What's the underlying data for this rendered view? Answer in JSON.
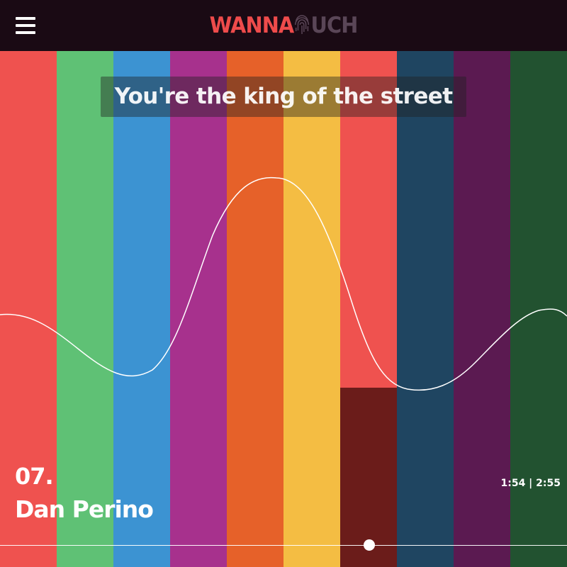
{
  "header": {
    "logo_part1": "WANNA",
    "logo_part2": "UCH",
    "logo_icon": "fingerprint-icon",
    "menu_icon": "hamburger-menu-icon"
  },
  "lyric": "You're the king of the street",
  "track": {
    "number": "07.",
    "artist": "Dan Perino"
  },
  "playback": {
    "elapsed": "1:54",
    "duration": "2:55",
    "time_display": "1:54 | 2:55",
    "progress": 0.6514
  },
  "stripes": [
    {
      "color": "#ef524f"
    },
    {
      "color": "#5fc175"
    },
    {
      "color": "#3c93d2"
    },
    {
      "color": "#a7318d"
    },
    {
      "color": "#e66129"
    },
    {
      "color": "#f4bd43"
    },
    {
      "color": "#ef524f"
    },
    {
      "color": "#1f4561"
    },
    {
      "color": "#5b1a51"
    },
    {
      "color": "#225230"
    }
  ],
  "active_level": {
    "stripe_index": 6,
    "fraction": 0.347,
    "color": "#6b1c1a"
  },
  "colors": {
    "header_bg": "#1a0a14",
    "logo_accent": "#ee4b4b",
    "logo_muted": "#5a4657",
    "text": "#ffffff"
  }
}
